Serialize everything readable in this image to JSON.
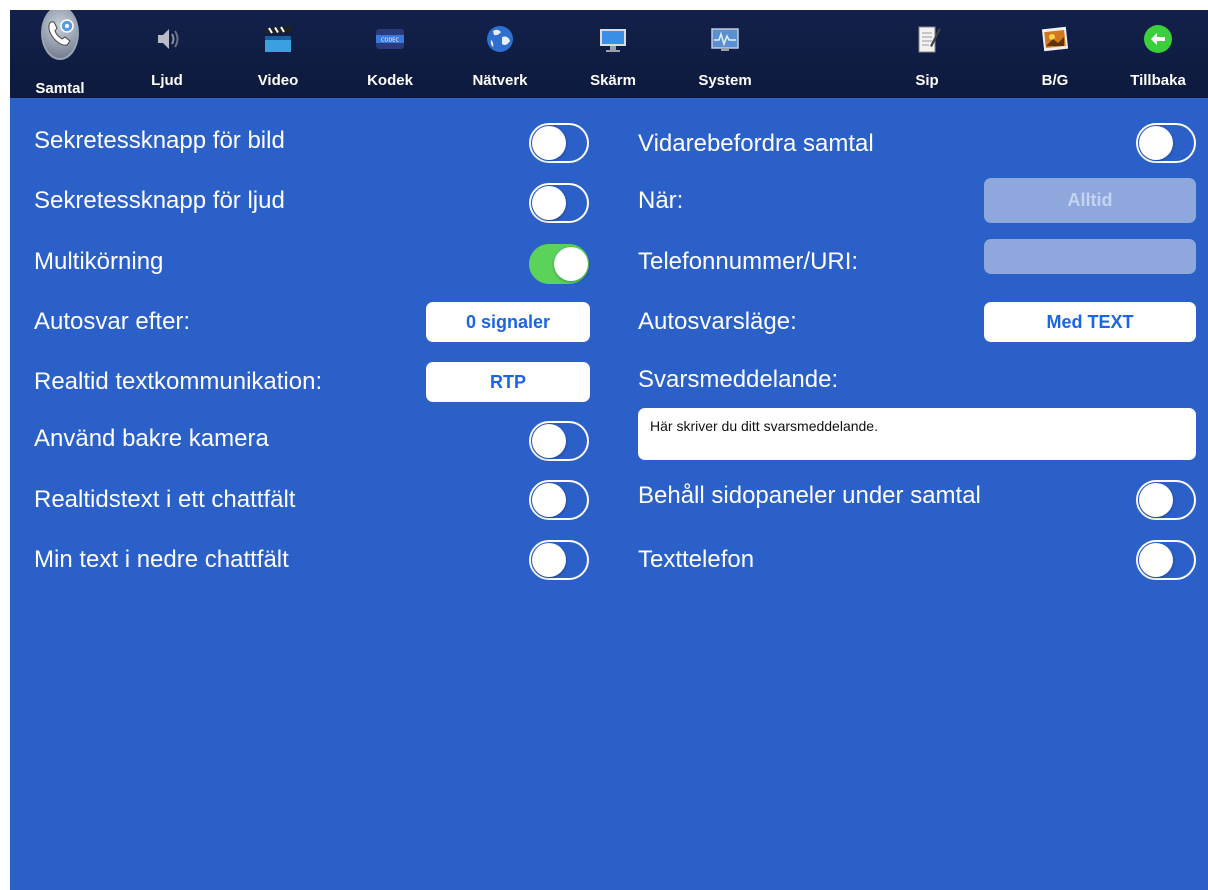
{
  "toolbar": {
    "tabs": [
      {
        "label": "Samtal",
        "icon": "phone-gear-icon",
        "selected": true
      },
      {
        "label": "Ljud",
        "icon": "speaker-icon"
      },
      {
        "label": "Video",
        "icon": "clapperboard-icon"
      },
      {
        "label": "Kodek",
        "icon": "codec-chip-icon",
        "icon_text": "CODEC"
      },
      {
        "label": "Nätverk",
        "icon": "globe-icon"
      },
      {
        "label": "Skärm",
        "icon": "monitor-icon"
      },
      {
        "label": "System",
        "icon": "system-monitor-icon"
      },
      {
        "label": "Sip",
        "icon": "notepad-icon"
      },
      {
        "label": "B/G",
        "icon": "picture-icon"
      },
      {
        "label": "Tillbaka",
        "icon": "back-arrow-icon"
      }
    ]
  },
  "left": {
    "privacy_video": {
      "label": "Sekretessknapp för bild",
      "on": false
    },
    "privacy_audio": {
      "label": "Sekretessknapp för ljud",
      "on": false
    },
    "multitasking": {
      "label": "Multikörning",
      "on": true
    },
    "autoanswer": {
      "label": "Autosvar efter:",
      "value": "0 signaler"
    },
    "realtime_text": {
      "label": "Realtid textkommunikation:",
      "value": "RTP"
    },
    "rear_camera": {
      "label": "Använd bakre kamera",
      "on": false
    },
    "rtt_single_field": {
      "label": "Realtidstext i ett chattfält",
      "on": false
    },
    "my_text_lower": {
      "label": "Min text i nedre chattfält",
      "on": false
    }
  },
  "right": {
    "forward_calls": {
      "label": "Vidarebefordra samtal",
      "on": false
    },
    "when": {
      "label": "När:",
      "value": "Alltid"
    },
    "phone_uri": {
      "label": "Telefonnummer/URI:",
      "value": ""
    },
    "autoanswer_mode": {
      "label": "Autosvarsläge:",
      "value": "Med TEXT"
    },
    "answer_message": {
      "label": "Svarsmeddelande:",
      "value": "Här skriver du ditt svarsmeddelande."
    },
    "keep_side_panels": {
      "label": "Behåll sidopaneler under samtal",
      "on": false
    },
    "text_telephone": {
      "label": "Texttelefon",
      "on": false
    }
  },
  "colors": {
    "background": "#2b60c8",
    "toolbar": "#13204a",
    "toggle_on": "#5bd35a",
    "pill_text": "#1a66e0"
  }
}
